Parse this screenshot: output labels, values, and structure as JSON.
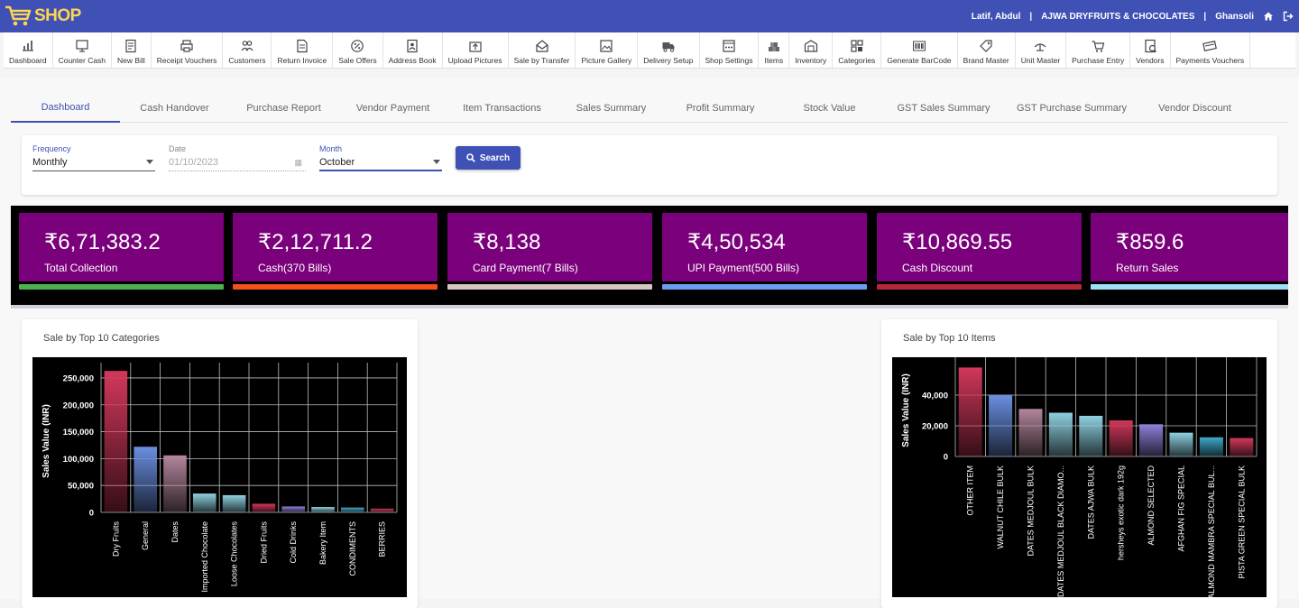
{
  "header": {
    "logo_text": "SHOP",
    "user_name": "Latif, Abdul",
    "separator": "|",
    "shop_name": "AJWA DRYFRUITS & CHOCOLATES",
    "location": "Ghansoli"
  },
  "toolbar": [
    {
      "label": "Dashboard",
      "icon": "chart-icon"
    },
    {
      "label": "Counter Cash",
      "icon": "monitor-icon"
    },
    {
      "label": "New Bill",
      "icon": "bill-icon"
    },
    {
      "label": "Receipt Vouchers",
      "icon": "printer-icon"
    },
    {
      "label": "Customers",
      "icon": "users-icon"
    },
    {
      "label": "Return Invoice",
      "icon": "invoice-icon"
    },
    {
      "label": "Sale Offers",
      "icon": "percent-icon"
    },
    {
      "label": "Address Book",
      "icon": "address-book-icon"
    },
    {
      "label": "Upload Pictures",
      "icon": "upload-icon"
    },
    {
      "label": "Sale by Transfer",
      "icon": "transfer-icon"
    },
    {
      "label": "Picture Gallery",
      "icon": "gallery-icon"
    },
    {
      "label": "Delivery Setup",
      "icon": "truck-icon"
    },
    {
      "label": "Shop Settings",
      "icon": "settings-icon"
    },
    {
      "label": "Items",
      "icon": "items-icon"
    },
    {
      "label": "Inventory",
      "icon": "warehouse-icon"
    },
    {
      "label": "Categories",
      "icon": "grid-icon"
    },
    {
      "label": "Generate BarCode",
      "icon": "barcode-icon"
    },
    {
      "label": "Brand Master",
      "icon": "tag-icon"
    },
    {
      "label": "Unit Master",
      "icon": "scale-icon"
    },
    {
      "label": "Purchase Entry",
      "icon": "cart-icon"
    },
    {
      "label": "Vendors",
      "icon": "vendor-icon"
    },
    {
      "label": "Payments Vouchers",
      "icon": "payment-icon"
    }
  ],
  "tabs": [
    {
      "label": "Dashboard",
      "active": true
    },
    {
      "label": "Cash Handover"
    },
    {
      "label": "Purchase Report"
    },
    {
      "label": "Vendor Payment"
    },
    {
      "label": "Item Transactions"
    },
    {
      "label": "Sales Summary"
    },
    {
      "label": "Profit Summary"
    },
    {
      "label": "Stock Value"
    },
    {
      "label": "GST Sales Summary"
    },
    {
      "label": "GST Purchase Summary"
    },
    {
      "label": "Vendor Discount"
    }
  ],
  "filters": {
    "frequency_label": "Frequency",
    "frequency_value": "Monthly",
    "date_label": "Date",
    "date_value": "01/10/2023",
    "month_label": "Month",
    "month_value": "October",
    "search_label": "Search"
  },
  "stats": [
    {
      "value": "₹6,71,383.2",
      "label": "Total Collection",
      "bar_color": "#4caf50"
    },
    {
      "value": "₹2,12,711.2",
      "label": "Cash(370 Bills)",
      "bar_color": "#f4511e"
    },
    {
      "value": "₹8,138",
      "label": "Card Payment(7 Bills)",
      "bar_color": "#d7c5c2"
    },
    {
      "value": "₹4,50,534",
      "label": "UPI Payment(500 Bills)",
      "bar_color": "#6a9ef0"
    },
    {
      "value": "₹10,869.55",
      "label": "Cash Discount",
      "bar_color": "#b5273a"
    },
    {
      "value": "₹859.6",
      "label": "Return Sales",
      "bar_color": "#9ee0f7"
    }
  ],
  "colors": {
    "primary": "#3f51b5",
    "stat_card": "#7b007b"
  },
  "chart_data": [
    {
      "type": "bar",
      "title": "Sale by Top 10 Categories",
      "ylabel": "Sales Value (INR)",
      "categories": [
        "Dry Fruits",
        "General",
        "Dates",
        "Imported Chocolate",
        "Loose Chocolates",
        "Dried Fruits",
        "Cold Drinks",
        "Bakery Item",
        "CONDIMENTS",
        "BERRIES"
      ],
      "values": [
        263000,
        122000,
        106000,
        35000,
        32000,
        16000,
        11000,
        10000,
        9000,
        7000
      ],
      "ylim": [
        0,
        265000
      ],
      "yticks": [
        0,
        50000,
        100000,
        150000,
        200000,
        250000
      ],
      "ytick_labels": [
        "0",
        "50,000",
        "100,000",
        "150,000",
        "200,000",
        "250,000"
      ],
      "bar_colors": [
        "#d2385b",
        "#6b8fe0",
        "#b3869c",
        "#8fd1e0",
        "#8fd1e0",
        "#d2385b",
        "#8f7fd8",
        "#8fd1e0",
        "#3fa8c8",
        "#d2385b"
      ],
      "grid": true
    },
    {
      "type": "bar",
      "title": "Sale by Top 10 Items",
      "ylabel": "Sales Value (INR)",
      "categories": [
        "OTHER ITEM",
        "WALNUT CHILE BULK",
        "DATES MEDJOUL BULK",
        "DATES MEDJOUL BLACK DIAMO...",
        "DATES AJWA BULK",
        "hersheys exotic dark 192g",
        "ALMOND SELECTED",
        "AFGHAN FIG SPECIAL",
        "ALMOND MAMBRA SPECIAL BUL...",
        "PISTA GREEN SPECIAL BULK"
      ],
      "values": [
        58000,
        40000,
        31000,
        28500,
        26500,
        23500,
        21000,
        15500,
        12500,
        12000
      ],
      "ylim": [
        0,
        60000
      ],
      "yticks": [
        0,
        20000,
        40000
      ],
      "ytick_labels": [
        "0",
        "20,000",
        "40,000"
      ],
      "bar_colors": [
        "#d2385b",
        "#6b8fe0",
        "#b3869c",
        "#8fd1e0",
        "#8fd1e0",
        "#d2385b",
        "#8f7fd8",
        "#8fd1e0",
        "#3fa8c8",
        "#d2385b"
      ],
      "grid": true
    }
  ]
}
